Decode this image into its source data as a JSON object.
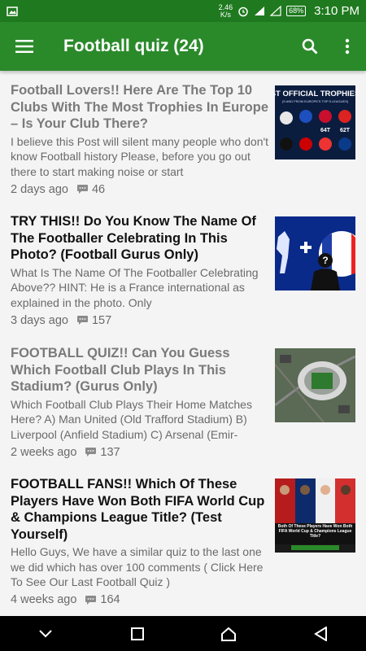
{
  "status_bar": {
    "net_speed_value": "2.46",
    "net_speed_unit": "K/s",
    "battery": "68%",
    "time": "3:10 PM"
  },
  "app_bar": {
    "title": "Football quiz (24)",
    "menu_icon": "hamburger-menu-icon",
    "search_icon": "search-icon",
    "overflow_icon": "more-vert-icon"
  },
  "colors": {
    "app_bar": "#2a8a2a",
    "status_bar": "#1f7a1f",
    "read_headline": "#7a7a7a",
    "unread_headline": "#111111"
  },
  "posts": [
    {
      "headline": "Football Lovers!! Here Are The Top 10 Clubs With The Most Trophies In Europe – Is Your Club There?",
      "excerpt": "I believe this Post will silent many people who don't know Football history Please, before you go out there to start making noise or start",
      "age": "2 days ago",
      "comments": "46",
      "read": true,
      "thumb_caption": "ST OFFICIAL TROPHIES",
      "thumb_sub": "(S AND FROM EUROPE'S TOP 5 LEAGUES)",
      "thumb_values": [
        "64T",
        "62T"
      ]
    },
    {
      "headline": "TRY THIS!! Do You Know The Name Of The Footballer Celebrating In This Photo? (Football Gurus Only)",
      "excerpt": "What Is The Name Of The Footballer Celebrating Above?? HINT: He is a France international as explained in the photo. Only",
      "age": "3 days ago",
      "comments": "157",
      "read": false
    },
    {
      "headline": "FOOTBALL QUIZ!! Can You Guess Which Football Club Plays In This Stadium? (Gurus Only)",
      "excerpt": "Which Football Club Plays Their Home Matches Here? A) Man United (Old Trafford Stadium) B) Liverpool (Anfield Stadium) C) Arsenal (Emir-",
      "age": "2 weeks ago",
      "comments": "137",
      "read": true
    },
    {
      "headline": "FOOTBALL FANS!! Which Of These Players Have Won Both FIFA World Cup & Champions League Title? (Test Yourself)",
      "excerpt": "Hello Guys, We have a similar quiz to the last one we did which has over 100 comments ( Click Here To See Our Last Football Quiz )",
      "age": "4 weeks ago",
      "comments": "164",
      "read": false,
      "thumb_caption": "Both Of These Players Have Won Both FIFA World Cup & Champions League Title?"
    }
  ],
  "nav_bar": {
    "icons": [
      "chevron-down-icon",
      "recents-square-icon",
      "home-icon",
      "back-triangle-icon"
    ]
  }
}
